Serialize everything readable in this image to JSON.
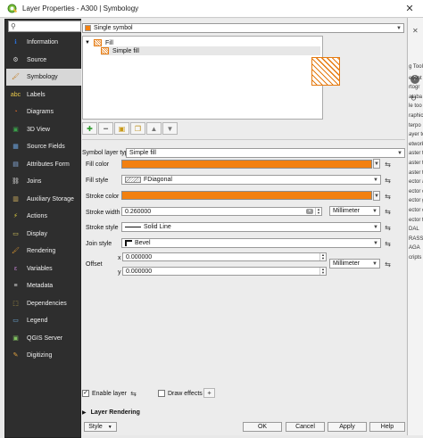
{
  "window": {
    "title": "Layer Properties - A300 | Symbology",
    "close": "✕"
  },
  "search": {
    "placeholder": ""
  },
  "sidebar": {
    "items": [
      {
        "label": "Information",
        "icon": "information-icon"
      },
      {
        "label": "Source",
        "icon": "source-icon"
      },
      {
        "label": "Symbology",
        "icon": "symbology-icon",
        "active": true
      },
      {
        "label": "Labels",
        "icon": "labels-icon"
      },
      {
        "label": "Diagrams",
        "icon": "diagrams-icon"
      },
      {
        "label": "3D View",
        "icon": "3d-view-icon"
      },
      {
        "label": "Source Fields",
        "icon": "source-fields-icon"
      },
      {
        "label": "Attributes Form",
        "icon": "attributes-form-icon"
      },
      {
        "label": "Joins",
        "icon": "joins-icon"
      },
      {
        "label": "Auxiliary Storage",
        "icon": "auxiliary-storage-icon"
      },
      {
        "label": "Actions",
        "icon": "actions-icon"
      },
      {
        "label": "Display",
        "icon": "display-icon"
      },
      {
        "label": "Rendering",
        "icon": "rendering-icon"
      },
      {
        "label": "Variables",
        "icon": "variables-icon"
      },
      {
        "label": "Metadata",
        "icon": "metadata-icon"
      },
      {
        "label": "Dependencies",
        "icon": "dependencies-icon"
      },
      {
        "label": "Legend",
        "icon": "legend-icon"
      },
      {
        "label": "QGIS Server",
        "icon": "qgis-server-icon"
      },
      {
        "label": "Digitizing",
        "icon": "digitizing-icon"
      }
    ]
  },
  "renderer": {
    "selected": "Single symbol"
  },
  "symbol_tree": {
    "root": "Fill",
    "child": "Simple fill"
  },
  "symbol_layer_type": {
    "label": "Symbol layer type",
    "value": "Simple fill"
  },
  "fields": {
    "fill_color": {
      "label": "Fill color",
      "color": "#f28010"
    },
    "fill_style": {
      "label": "Fill style",
      "value": "FDiagonal"
    },
    "stroke_color": {
      "label": "Stroke color",
      "color": "#f28010"
    },
    "stroke_width": {
      "label": "Stroke width",
      "value": "0.260000",
      "unit": "Millimeter"
    },
    "stroke_style": {
      "label": "Stroke style",
      "value": "Solid Line"
    },
    "join_style": {
      "label": "Join style",
      "value": "Bevel"
    },
    "offset": {
      "label": "Offset",
      "x_label": "x",
      "x": "0.000000",
      "y_label": "y",
      "y": "0.000000",
      "unit": "Millimeter"
    }
  },
  "bottom": {
    "enable_layer": "Enable layer",
    "draw_effects": "Draw effects",
    "layer_rendering": "Layer Rendering"
  },
  "buttons": {
    "style": "Style",
    "ok": "OK",
    "cancel": "Cancel",
    "apply": "Apply",
    "help": "Help"
  },
  "background_app": {
    "items": [
      "g Tool",
      "ecent",
      "rtogr",
      "ataba",
      "le too",
      "raphic",
      "terpo",
      "ayer to",
      "etwork",
      "aster t",
      "aster t",
      "aster t",
      "ector a",
      "ector c",
      "ector g",
      "ector o",
      "ector t",
      "DAL",
      "RASS",
      "AGA",
      "cripts"
    ]
  },
  "colors": {
    "accent": "#f28010",
    "sidebar_bg": "#2e2e2e"
  }
}
